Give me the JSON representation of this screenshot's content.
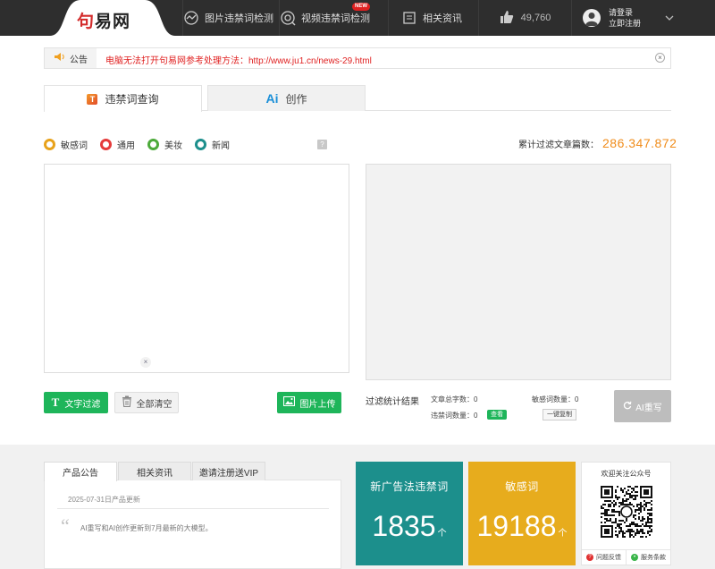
{
  "header": {
    "logo_prefix": "句",
    "logo_main": "易网",
    "nav": [
      {
        "label": "图片违禁词检测",
        "icon": "image-scan-icon"
      },
      {
        "label": "视频违禁词检测",
        "icon": "video-scan-icon",
        "badge": "NEW"
      },
      {
        "label": "相关资讯",
        "icon": "news-icon"
      }
    ],
    "likes": "49,760",
    "user": {
      "login": "请登录",
      "register": "立即注册"
    }
  },
  "notice": {
    "label": "公告",
    "text": "电脑无法打开句易网参考处理方法：http://www.ju1.cn/news-29.html",
    "close": "×"
  },
  "tabs": [
    {
      "label": "违禁词查询",
      "icon_text": "T"
    },
    {
      "label": "创作",
      "icon_text": "Ai"
    }
  ],
  "radios": [
    {
      "label": "敏感词",
      "color": "#e8a21a"
    },
    {
      "label": "通用",
      "color": "#e53b3b"
    },
    {
      "label": "美妆",
      "color": "#4caa3a"
    },
    {
      "label": "新闻",
      "color": "#1c8f8c"
    }
  ],
  "help": "?",
  "counter": {
    "label": "累计过滤文章篇数：",
    "value": "286.347.872"
  },
  "input_clear": "×",
  "buttons": {
    "filter": "文字过滤",
    "filter_icon_text": "T",
    "clear_all": "全部清空",
    "upload": "图片上传",
    "ai_rewrite": "AI重写"
  },
  "stats": {
    "title": "过滤统计结果",
    "total_words": "文章总字数：0",
    "banned_count": "违禁词数量：0",
    "sensitive_count": "敏感词数量：0",
    "view": "查看",
    "copy": "一键复制"
  },
  "bottom": {
    "tabs": [
      "产品公告",
      "相关资讯",
      "邀请注册送VIP"
    ],
    "news_date": "2025-07-31日产品更新",
    "quote_mark": "“",
    "news_text": "AI重写和AI创作更新到7月最新的大模型。",
    "cards": [
      {
        "title": "新广告法违禁词",
        "value": "1835",
        "unit": "个",
        "color": "#1c8f8c"
      },
      {
        "title": "敏感词",
        "value": "19188",
        "unit": "个",
        "color": "#e7ac1d"
      }
    ],
    "qr_title": "欢迎关注公众号",
    "feedback": "问题反馈",
    "terms": "服务条款"
  }
}
